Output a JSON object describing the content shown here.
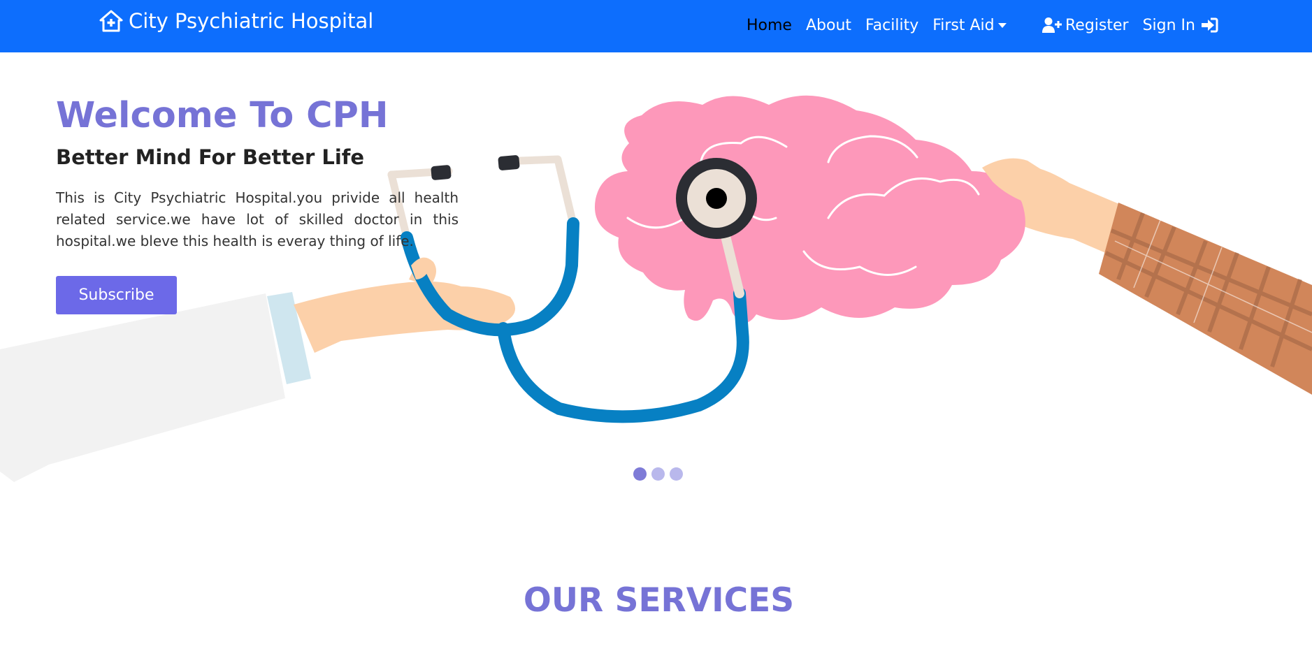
{
  "navbar": {
    "brand": "City Psychiatric Hospital",
    "links": [
      "Home",
      "About",
      "Facility",
      "First Aid"
    ],
    "register_label": "Register",
    "signin_label": "Sign In"
  },
  "hero": {
    "title": "Welcome To CPH",
    "subtitle": "Better Mind For Better Life",
    "text": "This is City Psychiatric Hospital.you privide all health related service.we have lot of skilled doctor in this hospital.we bleve this health is everay thing of life.",
    "subscribe_label": "Subscribe"
  },
  "carousel": {
    "slide_count": 3,
    "active_index": 0
  },
  "services": {
    "title": "OUR SERVICES"
  },
  "colors": {
    "navbar": "#0d6efd",
    "accent": "#7673d6",
    "button": "#6c69e8",
    "brain": "#fd98ba",
    "stethoscope": "#0780c3",
    "skin": "#fcd0a9",
    "sleeve": "#d1865a"
  },
  "icons": [
    "hospital-home-icon",
    "user-plus-icon",
    "sign-in-icon"
  ]
}
